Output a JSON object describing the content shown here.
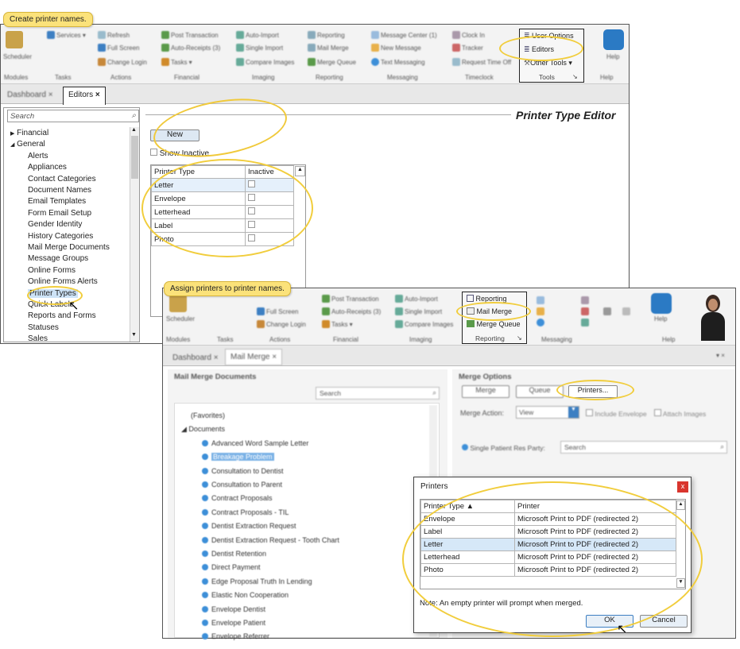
{
  "callouts": {
    "create": "Create printer names.",
    "assign": "Assign printers to printer names."
  },
  "win1": {
    "ribbon": {
      "modules": "Scheduler",
      "items": [
        "Services ▾",
        "Refresh",
        "Full Screen",
        "Change Login",
        "Post Transaction",
        "Auto-Receipts (3)",
        "Tasks ▾",
        "Auto-Import",
        "Single Import",
        "Compare Images",
        "Reporting",
        "Mail Merge",
        "Merge Queue",
        "Message Center (1)",
        "New Message",
        "Text Messaging",
        "Clock In",
        "Tracker",
        "Request Time Off"
      ],
      "groups": [
        "Modules",
        "Tasks",
        "Actions",
        "Financial",
        "Imaging",
        "Reporting",
        "Messaging",
        "Timeclock",
        "Tools",
        "Help"
      ],
      "tools": {
        "user_options": "User Options",
        "editors": "Editors",
        "other_tools": "Other Tools ▾",
        "label": "Tools"
      },
      "help": "Help"
    },
    "tabs": {
      "dashboard": "Dashboard",
      "editors": "Editors"
    },
    "search_placeholder": "Search",
    "title": "Printer Type Editor",
    "tree": [
      "Financial",
      "General",
      "Alerts",
      "Appliances",
      "Contact Categories",
      "Document Names",
      "Email Templates",
      "Form Email Setup",
      "Gender Identity",
      "History Categories",
      "Mail Merge Documents",
      "Message Groups",
      "Online Forms",
      "Online Forms Alerts",
      "Printer Types",
      "Quick Labels",
      "Reports and Forms",
      "Statuses",
      "Sales"
    ],
    "new_button": "New",
    "show_inactive": "Show Inactive",
    "table": {
      "headers": [
        "Printer Type",
        "Inactive"
      ],
      "rows": [
        "Letter",
        "Envelope",
        "Letterhead",
        "Label",
        "Photo"
      ]
    }
  },
  "win2": {
    "ribbon": {
      "modules": "Scheduler",
      "items": [
        "Full Screen",
        "Change Login",
        "Post Transaction",
        "Auto-Receipts (3)",
        "Tasks ▾",
        "Auto-Import",
        "Single Import",
        "Compare Images"
      ],
      "reporting": {
        "reporting": "Reporting",
        "mail_merge": "Mail Merge",
        "merge_queue": "Merge Queue",
        "label": "Reporting"
      },
      "groups": [
        "Modules",
        "Tasks",
        "Actions",
        "Financial",
        "Imaging",
        "Messaging",
        "Help"
      ],
      "help": "Help"
    },
    "tabs": {
      "dashboard": "Dashboard",
      "mail_merge": "Mail Merge"
    },
    "left_title": "Mail Merge Documents",
    "search_placeholder": "Search",
    "tree": [
      "(Favorites)",
      "Documents",
      "Advanced Word Sample Letter",
      "Breakage Problem",
      "Consultation to Dentist",
      "Consultation to Parent",
      "Contract Proposals",
      "Contract Proposals - TIL",
      "Dentist Extraction Request",
      "Dentist Extraction Request - Tooth Chart",
      "Dentist Retention",
      "Direct Payment",
      "Edge Proposal Truth In Lending",
      "Elastic Non Cooperation",
      "Envelope Dentist",
      "Envelope Patient",
      "Envelope Referrer"
    ],
    "merge_options": "Merge Options",
    "buttons": {
      "merge": "Merge",
      "queue": "Queue",
      "printers": "Printers..."
    },
    "merge_action_label": "Merge Action:",
    "merge_action_value": "View",
    "include_envelope": "Include Envelope",
    "attach_images": "Attach Images",
    "single_patient": "Single Patient Res Party:",
    "single_search": "Search"
  },
  "printers_dialog": {
    "title": "Printers",
    "close": "x",
    "headers": [
      "Printer Type ▲",
      "Printer"
    ],
    "rows": [
      {
        "type": "Envelope",
        "printer": "Microsoft Print to PDF (redirected 2)"
      },
      {
        "type": "Label",
        "printer": "Microsoft Print to PDF (redirected 2)"
      },
      {
        "type": "Letter",
        "printer": "Microsoft Print to PDF (redirected 2)"
      },
      {
        "type": "Letterhead",
        "printer": "Microsoft Print to PDF (redirected 2)"
      },
      {
        "type": "Photo",
        "printer": "Microsoft Print to PDF (redirected 2)"
      }
    ],
    "note": "Note: An empty printer will prompt when merged.",
    "ok": "OK",
    "cancel": "Cancel"
  }
}
